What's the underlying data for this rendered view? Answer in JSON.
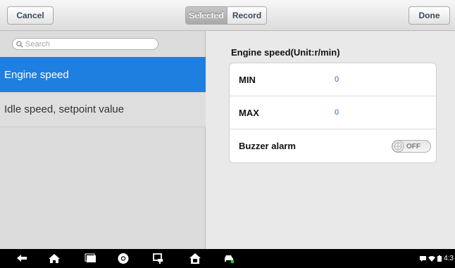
{
  "header": {
    "cancel_label": "Cancel",
    "done_label": "Done",
    "tabs": [
      {
        "label": "Selected",
        "active": true
      },
      {
        "label": "Record",
        "active": false
      }
    ]
  },
  "sidebar": {
    "search": {
      "placeholder": "Search",
      "value": ""
    },
    "items": [
      {
        "label": "Engine speed",
        "selected": true
      },
      {
        "label": "Idle speed, setpoint value",
        "selected": false
      }
    ]
  },
  "detail": {
    "title": "Engine speed(Unit:r/min)",
    "rows": [
      {
        "label": "MIN",
        "value": "0"
      },
      {
        "label": "MAX",
        "value": "0"
      },
      {
        "label": "Buzzer alarm",
        "toggle_label": "OFF",
        "toggle_on": false
      }
    ]
  },
  "navbar": {
    "icons": [
      "back-icon",
      "home-icon",
      "recent-apps-icon",
      "browser-icon",
      "screenshot-icon",
      "vci-home-icon",
      "car-icon"
    ],
    "status": {
      "time": "4:3",
      "icons": [
        "message-icon",
        "wifi-icon",
        "battery-icon"
      ]
    }
  },
  "colors": {
    "selected_item": "#1f7fe0",
    "value_text": "#2a62c8",
    "navbar": "#000000"
  }
}
